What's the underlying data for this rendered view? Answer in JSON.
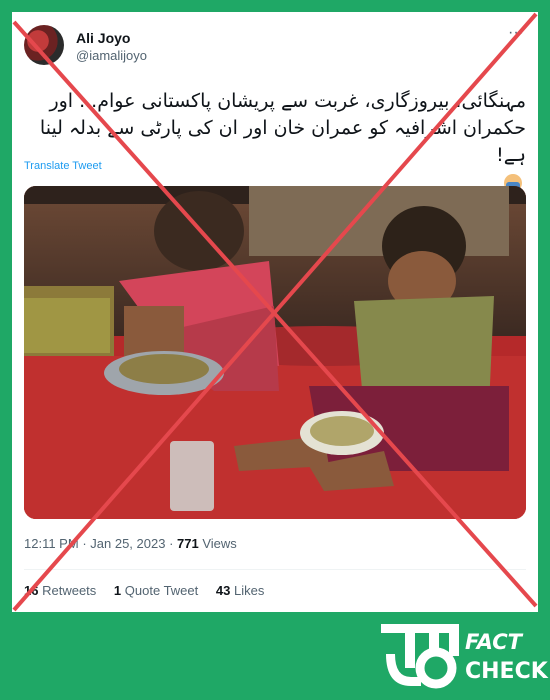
{
  "tweet": {
    "author_name": "Ali Joyo",
    "author_handle": "@iamalijoyo",
    "text_line1": "مہنگائی، بیروزگاری، غربت سے پریشان پاکستانی عوام... اور",
    "text_line2": "حکمران اشرافیہ کو عمران خان اور ان کی پارٹی سے بدلہ لینا ہے!",
    "translate_label": "Translate Tweet",
    "time": "12:11 PM",
    "date": "Jan 25, 2023",
    "views_count": "771",
    "views_label": "Views",
    "retweets_count": "16",
    "retweets_label": "Retweets",
    "quote_count": "1",
    "quote_label": "Quote Tweet",
    "likes_count": "43",
    "likes_label": "Likes"
  },
  "brand": {
    "line1": "FACT",
    "line2": "CHECK"
  },
  "colors": {
    "background": "#1fa866",
    "cross": "#e5484d",
    "link": "#1d9bf0"
  },
  "icons": [
    "more-icon",
    "facepalm-icon",
    "fact-check-logo-mark"
  ]
}
